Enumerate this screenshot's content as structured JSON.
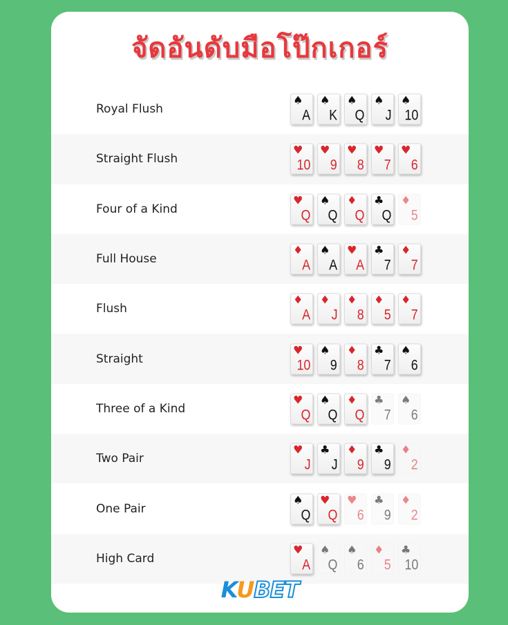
{
  "title": "จัดอันดับมือโป๊กเกอร์",
  "colors": {
    "background": "#5abf78",
    "title": "#e8383d",
    "red_suit": "#d9262c",
    "black_suit": "#111111",
    "logo_blue": "#1a8fd8",
    "logo_orange": "#f59a1b"
  },
  "suit_icons": {
    "spades": "♠",
    "hearts": "♥",
    "diamonds": "♦",
    "clubs": "♣"
  },
  "hands": [
    {
      "name": "Royal Flush",
      "cards": [
        {
          "rank": "A",
          "suit": "♠",
          "color": "black",
          "faded": false
        },
        {
          "rank": "K",
          "suit": "♠",
          "color": "black",
          "faded": false
        },
        {
          "rank": "Q",
          "suit": "♠",
          "color": "black",
          "faded": false
        },
        {
          "rank": "J",
          "suit": "♠",
          "color": "black",
          "faded": false
        },
        {
          "rank": "10",
          "suit": "♠",
          "color": "black",
          "faded": false
        }
      ]
    },
    {
      "name": "Straight Flush",
      "cards": [
        {
          "rank": "10",
          "suit": "♥",
          "color": "red",
          "faded": false
        },
        {
          "rank": "9",
          "suit": "♥",
          "color": "red",
          "faded": false
        },
        {
          "rank": "8",
          "suit": "♥",
          "color": "red",
          "faded": false
        },
        {
          "rank": "7",
          "suit": "♥",
          "color": "red",
          "faded": false
        },
        {
          "rank": "6",
          "suit": "♥",
          "color": "red",
          "faded": false
        }
      ]
    },
    {
      "name": "Four of a Kind",
      "cards": [
        {
          "rank": "Q",
          "suit": "♥",
          "color": "red",
          "faded": false
        },
        {
          "rank": "Q",
          "suit": "♠",
          "color": "black",
          "faded": false
        },
        {
          "rank": "Q",
          "suit": "♦",
          "color": "red",
          "faded": false
        },
        {
          "rank": "Q",
          "suit": "♣",
          "color": "black",
          "faded": false
        },
        {
          "rank": "5",
          "suit": "♦",
          "color": "red",
          "faded": true
        }
      ]
    },
    {
      "name": "Full House",
      "cards": [
        {
          "rank": "A",
          "suit": "♦",
          "color": "red",
          "faded": false
        },
        {
          "rank": "A",
          "suit": "♠",
          "color": "black",
          "faded": false
        },
        {
          "rank": "A",
          "suit": "♥",
          "color": "red",
          "faded": false
        },
        {
          "rank": "7",
          "suit": "♣",
          "color": "black",
          "faded": false
        },
        {
          "rank": "7",
          "suit": "♦",
          "color": "red",
          "faded": false
        }
      ]
    },
    {
      "name": "Flush",
      "cards": [
        {
          "rank": "A",
          "suit": "♦",
          "color": "red",
          "faded": false
        },
        {
          "rank": "J",
          "suit": "♦",
          "color": "red",
          "faded": false
        },
        {
          "rank": "8",
          "suit": "♦",
          "color": "red",
          "faded": false
        },
        {
          "rank": "5",
          "suit": "♦",
          "color": "red",
          "faded": false
        },
        {
          "rank": "7",
          "suit": "♦",
          "color": "red",
          "faded": false
        }
      ]
    },
    {
      "name": "Straight",
      "cards": [
        {
          "rank": "10",
          "suit": "♥",
          "color": "red",
          "faded": false
        },
        {
          "rank": "9",
          "suit": "♠",
          "color": "black",
          "faded": false
        },
        {
          "rank": "8",
          "suit": "♦",
          "color": "red",
          "faded": false
        },
        {
          "rank": "7",
          "suit": "♣",
          "color": "black",
          "faded": false
        },
        {
          "rank": "6",
          "suit": "♠",
          "color": "black",
          "faded": false
        }
      ]
    },
    {
      "name": "Three of a Kind",
      "cards": [
        {
          "rank": "Q",
          "suit": "♥",
          "color": "red",
          "faded": false
        },
        {
          "rank": "Q",
          "suit": "♠",
          "color": "black",
          "faded": false
        },
        {
          "rank": "Q",
          "suit": "♦",
          "color": "red",
          "faded": false
        },
        {
          "rank": "7",
          "suit": "♣",
          "color": "black",
          "faded": true
        },
        {
          "rank": "6",
          "suit": "♠",
          "color": "black",
          "faded": true
        }
      ]
    },
    {
      "name": "Two Pair",
      "cards": [
        {
          "rank": "J",
          "suit": "♥",
          "color": "red",
          "faded": false
        },
        {
          "rank": "J",
          "suit": "♣",
          "color": "black",
          "faded": false
        },
        {
          "rank": "9",
          "suit": "♦",
          "color": "red",
          "faded": false
        },
        {
          "rank": "9",
          "suit": "♣",
          "color": "black",
          "faded": false
        },
        {
          "rank": "2",
          "suit": "♦",
          "color": "red",
          "faded": true
        }
      ]
    },
    {
      "name": "One Pair",
      "cards": [
        {
          "rank": "Q",
          "suit": "♠",
          "color": "black",
          "faded": false
        },
        {
          "rank": "Q",
          "suit": "♥",
          "color": "red",
          "faded": false
        },
        {
          "rank": "6",
          "suit": "♥",
          "color": "red",
          "faded": true
        },
        {
          "rank": "9",
          "suit": "♣",
          "color": "black",
          "faded": true
        },
        {
          "rank": "2",
          "suit": "♦",
          "color": "red",
          "faded": true
        }
      ]
    },
    {
      "name": "High Card",
      "cards": [
        {
          "rank": "A",
          "suit": "♥",
          "color": "red",
          "faded": false
        },
        {
          "rank": "Q",
          "suit": "♠",
          "color": "black",
          "faded": true
        },
        {
          "rank": "6",
          "suit": "♠",
          "color": "black",
          "faded": true
        },
        {
          "rank": "5",
          "suit": "♦",
          "color": "red",
          "faded": true
        },
        {
          "rank": "10",
          "suit": "♣",
          "color": "black",
          "faded": true
        }
      ]
    }
  ],
  "logo": {
    "part1": "K",
    "part2": "U",
    "part3": "BET"
  }
}
